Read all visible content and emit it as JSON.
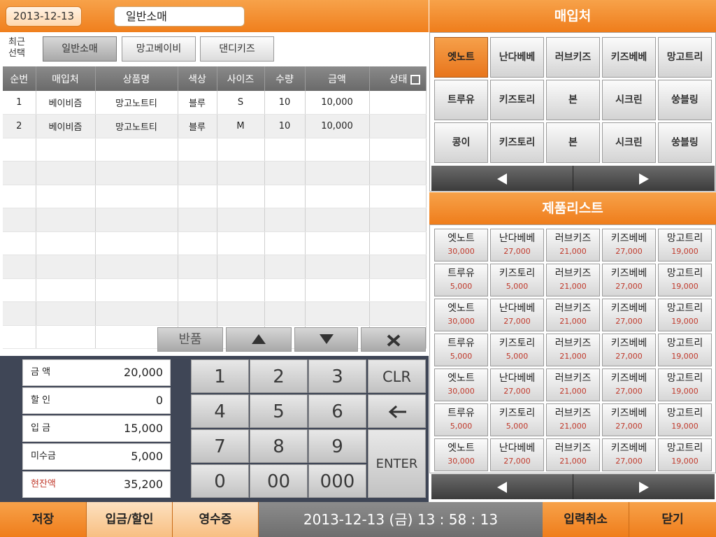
{
  "header": {
    "date": "2013-12-13",
    "mode": "일반소매"
  },
  "recent": {
    "label": "최근\n선택",
    "buttons": [
      "일반소매",
      "망고베이비",
      "댄디키즈"
    ]
  },
  "table": {
    "headers": [
      "순번",
      "매입처",
      "상품명",
      "색상",
      "사이즈",
      "수량",
      "금액",
      "상태"
    ],
    "rows": [
      {
        "no": "1",
        "supplier": "베이비즘",
        "product": "망고노트티",
        "color": "블루",
        "size": "S",
        "qty": "10",
        "amount": "10,000",
        "status": ""
      },
      {
        "no": "2",
        "supplier": "베이비즘",
        "product": "망고노트티",
        "color": "블루",
        "size": "M",
        "qty": "10",
        "amount": "10,000",
        "status": ""
      }
    ]
  },
  "actions": {
    "return": "반품"
  },
  "amounts": [
    {
      "label": "금 액",
      "value": "20,000"
    },
    {
      "label": "할 인",
      "value": "0"
    },
    {
      "label": "입 금",
      "value": "15,000"
    },
    {
      "label": "미수금",
      "value": "5,000"
    },
    {
      "label": "현잔액",
      "value": "35,200"
    }
  ],
  "keypad": {
    "digits": [
      "1",
      "2",
      "3",
      "4",
      "5",
      "6",
      "7",
      "8",
      "9",
      "0",
      "00",
      "000"
    ],
    "clear": "CLR",
    "enter": "ENTER"
  },
  "suppliers": {
    "title": "매입처",
    "items": [
      "엣노트",
      "난다베베",
      "러브키즈",
      "키즈베베",
      "망고트리",
      "트루유",
      "키즈토리",
      "본",
      "시크린",
      "쑹블링",
      "콩이",
      "키즈토리",
      "본",
      "시크린",
      "쑹블링"
    ]
  },
  "products": {
    "title": "제품리스트",
    "items": [
      {
        "name": "엣노트",
        "price": "30,000"
      },
      {
        "name": "난다베베",
        "price": "27,000"
      },
      {
        "name": "러브키즈",
        "price": "21,000"
      },
      {
        "name": "키즈베베",
        "price": "27,000"
      },
      {
        "name": "망고트리",
        "price": "19,000"
      },
      {
        "name": "트루유",
        "price": "5,000"
      },
      {
        "name": "키즈토리",
        "price": "5,000"
      },
      {
        "name": "러브키즈",
        "price": "21,000"
      },
      {
        "name": "키즈베베",
        "price": "27,000"
      },
      {
        "name": "망고트리",
        "price": "19,000"
      },
      {
        "name": "엣노트",
        "price": "30,000"
      },
      {
        "name": "난다베베",
        "price": "27,000"
      },
      {
        "name": "러브키즈",
        "price": "21,000"
      },
      {
        "name": "키즈베베",
        "price": "27,000"
      },
      {
        "name": "망고트리",
        "price": "19,000"
      },
      {
        "name": "트루유",
        "price": "5,000"
      },
      {
        "name": "키즈토리",
        "price": "5,000"
      },
      {
        "name": "러브키즈",
        "price": "21,000"
      },
      {
        "name": "키즈베베",
        "price": "27,000"
      },
      {
        "name": "망고트리",
        "price": "19,000"
      },
      {
        "name": "엣노트",
        "price": "30,000"
      },
      {
        "name": "난다베베",
        "price": "27,000"
      },
      {
        "name": "러브키즈",
        "price": "21,000"
      },
      {
        "name": "키즈베베",
        "price": "27,000"
      },
      {
        "name": "망고트리",
        "price": "19,000"
      },
      {
        "name": "트루유",
        "price": "5,000"
      },
      {
        "name": "키즈토리",
        "price": "5,000"
      },
      {
        "name": "러브키즈",
        "price": "21,000"
      },
      {
        "name": "키즈베베",
        "price": "27,000"
      },
      {
        "name": "망고트리",
        "price": "19,000"
      },
      {
        "name": "엣노트",
        "price": "30,000"
      },
      {
        "name": "난다베베",
        "price": "27,000"
      },
      {
        "name": "러브키즈",
        "price": "21,000"
      },
      {
        "name": "키즈베베",
        "price": "27,000"
      },
      {
        "name": "망고트리",
        "price": "19,000"
      }
    ]
  },
  "footer": {
    "save": "저장",
    "deposit_discount": "입금/할인",
    "receipt": "영수증",
    "datetime": "2013-12-13 (금) 13 : 58 : 13",
    "cancel_input": "입력취소",
    "close": "닫기"
  },
  "colors": {
    "accent": "#f08a2a",
    "dark_panel": "#3f4656",
    "price_red": "#c0392b"
  }
}
